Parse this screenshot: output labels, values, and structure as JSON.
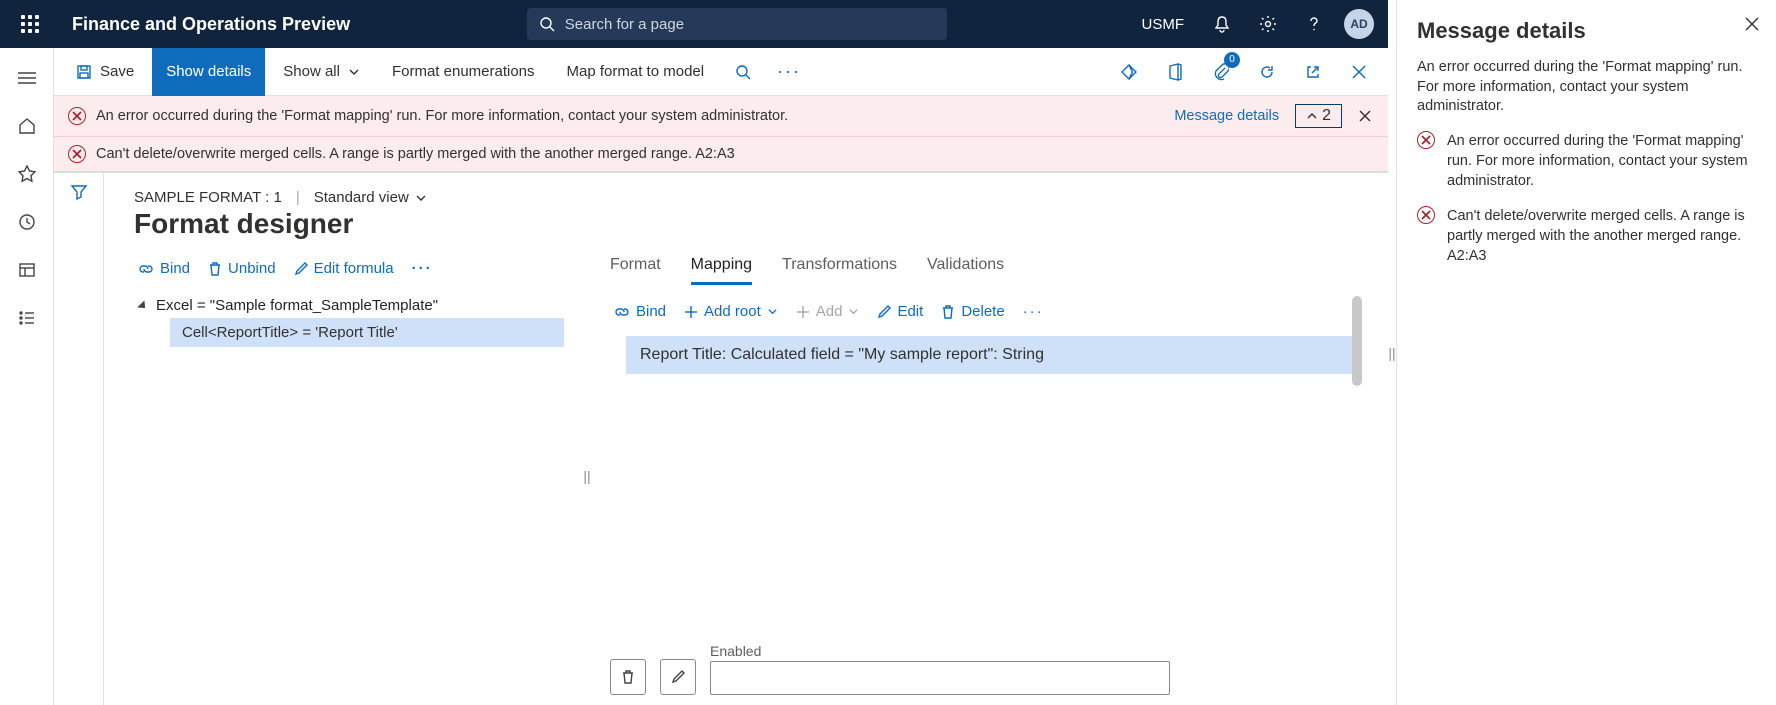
{
  "header": {
    "appTitle": "Finance and Operations Preview",
    "searchPlaceholder": "Search for a page",
    "company": "USMF",
    "avatar": "AD"
  },
  "commands": {
    "save": "Save",
    "showDetails": "Show details",
    "showAll": "Show all",
    "formatEnum": "Format enumerations",
    "mapFormat": "Map format to model",
    "attachCount": "0"
  },
  "banner": {
    "msg1": "An error occurred during the 'Format mapping' run. For more information, contact your system administrator.",
    "msg2": "Can't delete/overwrite merged cells. A range is partly merged with the another merged range. A2:A3",
    "detailsLink": "Message details",
    "count": "2"
  },
  "page": {
    "breadcrumb": "SAMPLE FORMAT : 1",
    "view": "Standard view",
    "title": "Format designer"
  },
  "leftToolbar": {
    "bind": "Bind",
    "unbind": "Unbind",
    "editFormula": "Edit formula"
  },
  "tree": {
    "root": "Excel = \"Sample format_SampleTemplate\"",
    "child": "Cell<ReportTitle> = 'Report Title'"
  },
  "tabs": {
    "format": "Format",
    "mapping": "Mapping",
    "transformations": "Transformations",
    "validations": "Validations"
  },
  "rightToolbar": {
    "bind": "Bind",
    "addRoot": "Add root",
    "add": "Add",
    "edit": "Edit",
    "delete": "Delete"
  },
  "mappingRow": "Report Title: Calculated field = \"My sample report\": String",
  "bottom": {
    "enabledLabel": "Enabled"
  },
  "detailsPane": {
    "title": "Message details",
    "desc": "An error occurred during the 'Format mapping' run. For more information, contact your system administrator.",
    "item1": "An error occurred during the 'Format mapping' run. For more information, contact your system administrator.",
    "item2": "Can't delete/overwrite merged cells. A range is partly merged with the another merged range. A2:A3"
  }
}
